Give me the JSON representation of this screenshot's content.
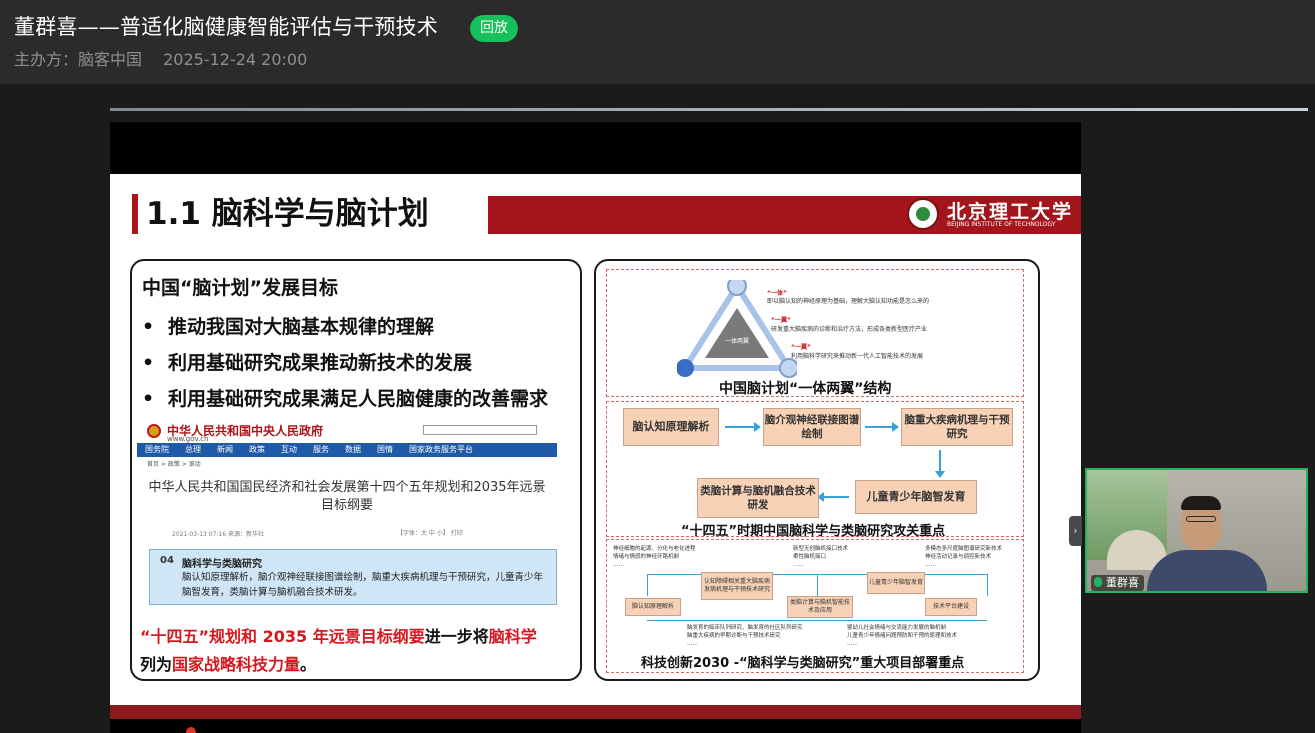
{
  "header": {
    "title": "董群喜——普适化脑健康智能评估与干预技术",
    "badge": "回放",
    "organizer": "主办方：脑客中国",
    "datetime": "2025-12-24 20:00"
  },
  "slide": {
    "title": "1.1 脑科学与脑计划",
    "logo_cn": "北京理工大学",
    "logo_en": "BEIJING INSTITUTE OF TECHNOLOGY",
    "left": {
      "heading": "中国“脑计划”发展目标",
      "bullets": [
        "推动我国对大脑基本规律的理解",
        "利用基础研究成果推动新技术的发展",
        "利用基础研究成果满足人民脑健康的改善需求"
      ],
      "gov": {
        "name": "中华人民共和国中央人民政府",
        "url": "www.gov.cn",
        "nav": [
          "国务院",
          "总理",
          "新闻",
          "政策",
          "互动",
          "服务",
          "数据",
          "国情",
          "国家政务服务平台"
        ],
        "breadcrumb": "首页 > 政策 > 滚动",
        "doc_title": "中华人民共和国国民经济和社会发展第十四个五年规划和2035年远景目标纲要",
        "doc_meta": "2021-03-13 07:16   来源：新华社",
        "doc_tools": "【字体：大 中 小】 打印",
        "box_num": "04",
        "box_title": "脑科学与类脑研究",
        "box_text": "脑认知原理解析，脑介观神经联接图谱绘制，脑重大疾病机理与干预研究，儿童青少年脑智发育，类脑计算与脑机融合技术研发。"
      },
      "footer": {
        "p1": "“十四五”规划和 2035 年远景目标纲要",
        "p2": "进一步将",
        "p3": "脑科学",
        "p4": "列为",
        "p5": "国家战略科技力量",
        "p6": "。"
      }
    },
    "right": {
      "triangle_center": "一体两翼",
      "one_body_label": "“一体”",
      "one_body_text": "即以脑认知的神经原理为基础，理解大脑认知功能是怎么来的",
      "wing1_label": "“一翼”",
      "wing1_text": "研发重大脑疾病的诊断和治疗方法，形成各类新型医疗产业",
      "wing2_label": "“一翼”",
      "wing2_text": "利用脑科学研究来推动新一代人工智能技术的发展",
      "caption1": "中国脑计划“一体两翼”结构",
      "flow": [
        "脑认知原理解析",
        "脑介观神经联接图谱绘制",
        "脑重大疾病机理与干预研究",
        "类脑计算与脑机融合技术研发",
        "儿童青少年脑智发育"
      ],
      "caption2": "“十四五”时期中国脑科学与类脑研究攻关重点",
      "mini_top": [
        "神经细胞的起源、分化与老化进程",
        "情绪与情感的神经环路机制",
        "……",
        "新型无创脑机接口技术",
        "柔性脑机接口",
        "……",
        "多模态多尺度脑图谱研究新技术",
        "神经活动记录与调控新技术",
        "……"
      ],
      "mini_boxes": [
        "认知障碍相关重大脑疾病发病机理与干预技术研究",
        "儿童青少年脑智发育",
        "脑认知原理解析",
        "类脑计算与脑机智能技术及应用",
        "技术平台建设"
      ],
      "mini_bottom": [
        "脑发育的临床队列研究、脑发育的社区队列研究",
        "脑重大疾病的早期诊断与干预技术研究",
        "……",
        "婴幼儿社会情绪与交流能力发展的脑机制",
        "儿童青少年情绪问题预防和干预的原理和技术",
        "……"
      ],
      "caption3": "科技创新2030 -“脑科学与类脑研究”重大项目部署重点"
    }
  },
  "pip": {
    "name": "董群喜"
  }
}
